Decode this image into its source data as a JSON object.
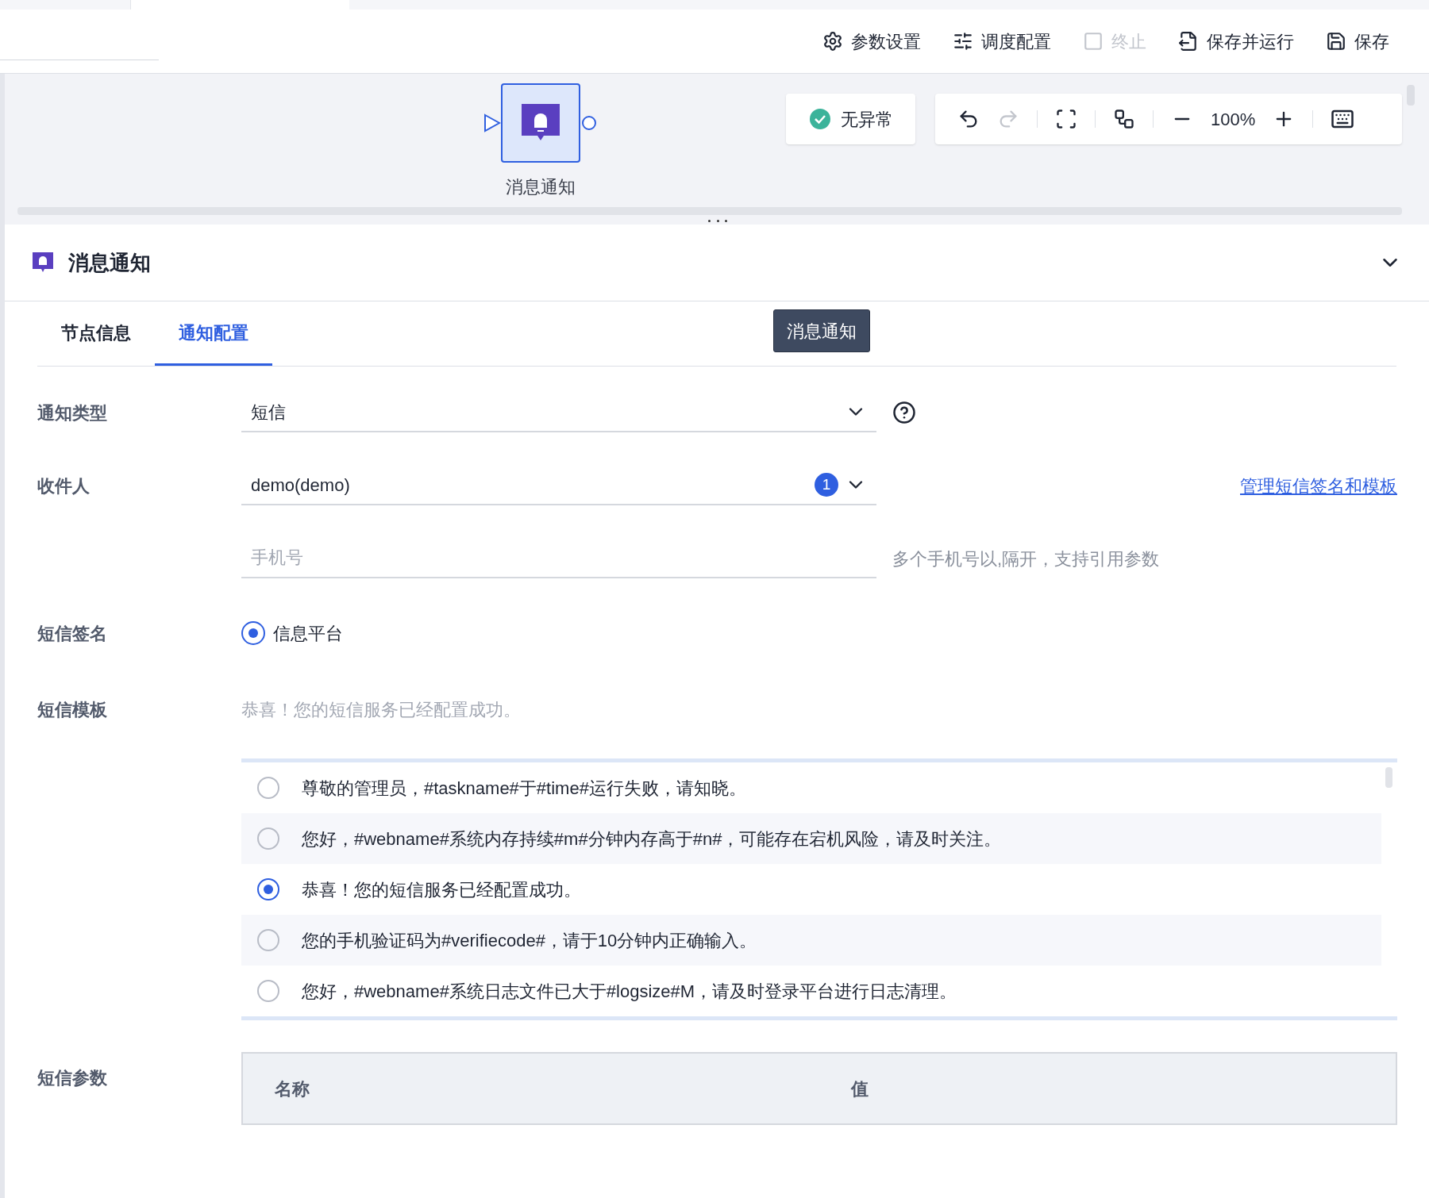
{
  "toolbar": [
    {
      "kind": "settings",
      "label": "参数设置",
      "disabled": false
    },
    {
      "kind": "schedule",
      "label": "调度配置",
      "disabled": false
    },
    {
      "kind": "stop",
      "label": "终止",
      "disabled": true
    },
    {
      "kind": "save_run",
      "label": "保存并运行",
      "disabled": false
    },
    {
      "kind": "save",
      "label": "保存",
      "disabled": false
    }
  ],
  "canvas": {
    "node": {
      "label": "消息通知",
      "selected": true
    },
    "status": "无异常",
    "zoom": "100%",
    "redo_disabled": true
  },
  "panel": {
    "title": "消息通知",
    "expanded": true,
    "tooltip": "消息通知",
    "tabs": [
      {
        "label": "节点信息",
        "selected": false
      },
      {
        "label": "通知配置",
        "selected": true
      }
    ]
  },
  "form": {
    "notify_type": {
      "label": "通知类型",
      "value": "短信"
    },
    "recipients": {
      "label": "收件人",
      "value": "demo(demo)",
      "count": "1",
      "link": "管理短信签名和模板"
    },
    "phone": {
      "placeholder": "手机号",
      "hint": "多个手机号以,隔开，支持引用参数"
    },
    "signature": {
      "label": "短信签名",
      "options": [
        {
          "label": "信息平台",
          "selected": true
        }
      ]
    },
    "template": {
      "label": "短信模板",
      "placeholder": "恭喜！您的短信服务已经配置成功。",
      "options": [
        {
          "text": "尊敬的管理员，#taskname#于#time#运行失败，请知晓。",
          "selected": false
        },
        {
          "text": "您好，#webname#系统内存持续#m#分钟内存高于#n#，可能存在宕机风险，请及时关注。",
          "selected": false
        },
        {
          "text": "恭喜！您的短信服务已经配置成功。",
          "selected": true
        },
        {
          "text": "您的手机验证码为#verifiecode#，请于10分钟内正确输入。",
          "selected": false
        },
        {
          "text": "您好，#webname#系统日志文件已大于#logsize#M，请及时登录平台进行日志清理。",
          "selected": false
        }
      ]
    },
    "params": {
      "label": "短信参数",
      "columns": [
        "名称",
        "值"
      ]
    }
  }
}
